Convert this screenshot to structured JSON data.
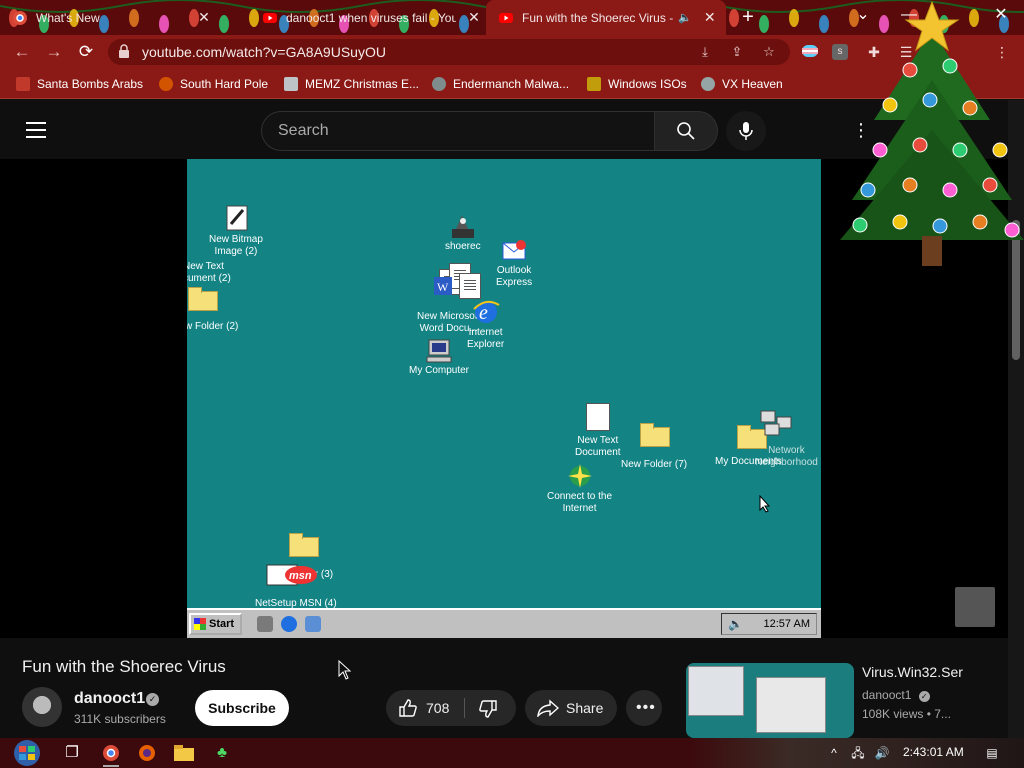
{
  "browser": {
    "tabs": [
      {
        "title": "What's New",
        "active": false,
        "favicon": "chrome-icon"
      },
      {
        "title": "danooct1 when viruses fail - You",
        "active": false,
        "favicon": "youtube-icon"
      },
      {
        "title": "Fun with the Shoerec Virus -",
        "active": true,
        "favicon": "youtube-icon",
        "audio": true
      }
    ],
    "url": "youtube.com/watch?v=GA8A9USuyOU",
    "bookmarks": [
      {
        "label": "Santa Bombs Arabs",
        "color": "#c0392b"
      },
      {
        "label": "South Hard Pole",
        "color": "#d35400"
      },
      {
        "label": "MEMZ Christmas E...",
        "color": "#bdc3c7"
      },
      {
        "label": "Endermanch Malwa...",
        "color": "#7f8c8d"
      },
      {
        "label": "Windows ISOs",
        "color": "#c29d0b"
      },
      {
        "label": "VX Heaven",
        "color": "#95a5a6"
      }
    ],
    "theme_color": "#8b1a16"
  },
  "youtube": {
    "search_placeholder": "Search",
    "video": {
      "title": "Fun with the Shoerec Virus",
      "channel": "danooct1",
      "subscribers": "311K subscribers",
      "subscribe_label": "Subscribe",
      "likes": "708",
      "share_label": "Share"
    },
    "recommended": {
      "title": "Virus.Win32.Ser",
      "channel": "danooct1",
      "meta": "108K views  •  7..."
    }
  },
  "win95": {
    "start_label": "Start",
    "clock": "12:57 AM",
    "icons": [
      {
        "label": "New Bitmap\nImage (2)"
      },
      {
        "label": "New Text\ncument (2)"
      },
      {
        "label": "w Folder (2)"
      },
      {
        "label": "shoerec"
      },
      {
        "label": "Outlook\nExpress"
      },
      {
        "label": "New Microsoft\nWord Docu..."
      },
      {
        "label": "Internet\nExplorer"
      },
      {
        "label": "My Computer"
      },
      {
        "label": "New Text\nDocument"
      },
      {
        "label": "New Folder (7)"
      },
      {
        "label": "My Documents"
      },
      {
        "label": "Network\nNeighborhood"
      },
      {
        "label": "Connect to the\nInternet"
      },
      {
        "label": "New Folder (3)"
      },
      {
        "label": "NetSetup MSN (4)"
      }
    ]
  },
  "taskbar": {
    "time": "2:43:01 AM"
  }
}
